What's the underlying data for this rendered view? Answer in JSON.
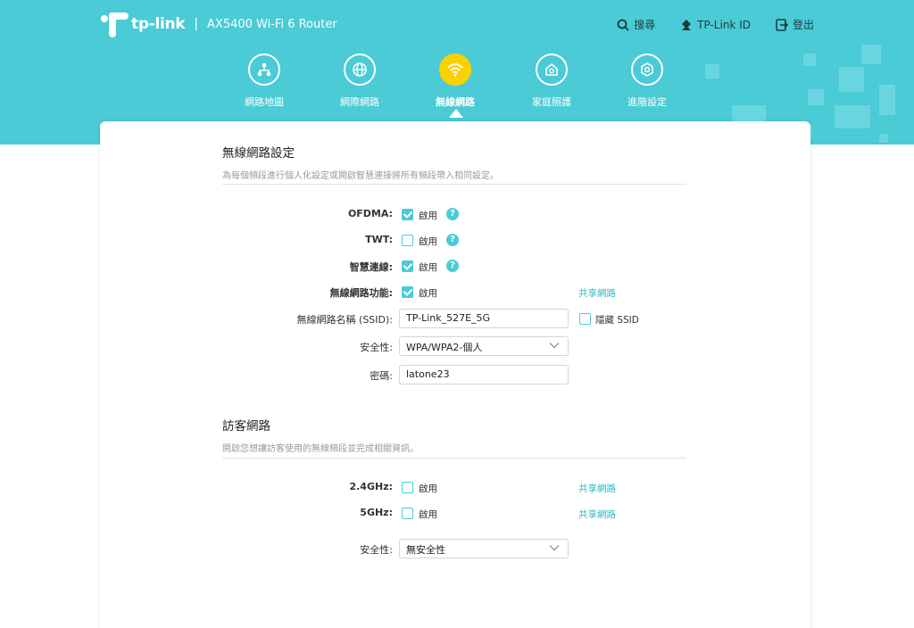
{
  "header": {
    "brand": "tp-link",
    "separator": "|",
    "model": "AX5400 Wi-Fi 6 Router",
    "top_links": {
      "search": "搜尋",
      "tplink_id": "TP-Link ID",
      "logout": "登出"
    }
  },
  "nav": {
    "items": [
      {
        "label": "網路地圖",
        "icon": "network-map-icon"
      },
      {
        "label": "網際網路",
        "icon": "globe-icon"
      },
      {
        "label": "無線網路",
        "icon": "wifi-icon",
        "active": true
      },
      {
        "label": "家庭照護",
        "icon": "home-care-icon"
      },
      {
        "label": "進階設定",
        "icon": "gear-icon"
      }
    ]
  },
  "wireless_settings": {
    "title": "無線網路設定",
    "description": "為每個頻段進行個人化設定或開啟智慧連接將所有頻段帶入相同設定。",
    "ofdma": {
      "label": "OFDMA:",
      "checkbox_text": "啟用",
      "checked": true
    },
    "twt": {
      "label": "TWT:",
      "checkbox_text": "啟用",
      "checked": false
    },
    "smart_connect": {
      "label": "智慧連線:",
      "checkbox_text": "啟用",
      "checked": true
    },
    "wireless_function": {
      "label": "無線網路功能:",
      "checkbox_text": "啟用",
      "checked": true,
      "share_link": "共享網路"
    },
    "ssid": {
      "label": "無線網路名稱 (SSID):",
      "value": "TP-Link_527E_5G",
      "hide_label": "隱藏 SSID"
    },
    "security": {
      "label": "安全性:",
      "value": "WPA/WPA2-個人"
    },
    "password": {
      "label": "密碼:",
      "value": "latone23"
    }
  },
  "guest_network": {
    "title": "訪客網路",
    "description": "開啟您想讓訪客使用的無線頻段並完成相關資訊。",
    "band_24": {
      "label": "2.4GHz:",
      "checkbox_text": "啟用",
      "checked": false,
      "share_link": "共享網路"
    },
    "band_5": {
      "label": "5GHz:",
      "checkbox_text": "啟用",
      "checked": false,
      "share_link": "共享網路"
    },
    "security": {
      "label": "安全性:",
      "value": "無安全性"
    }
  },
  "colors": {
    "header_bg": "#4acbd6",
    "accent": "#4acbd6",
    "active_nav": "#fcd100",
    "link": "#2fb8c6"
  }
}
